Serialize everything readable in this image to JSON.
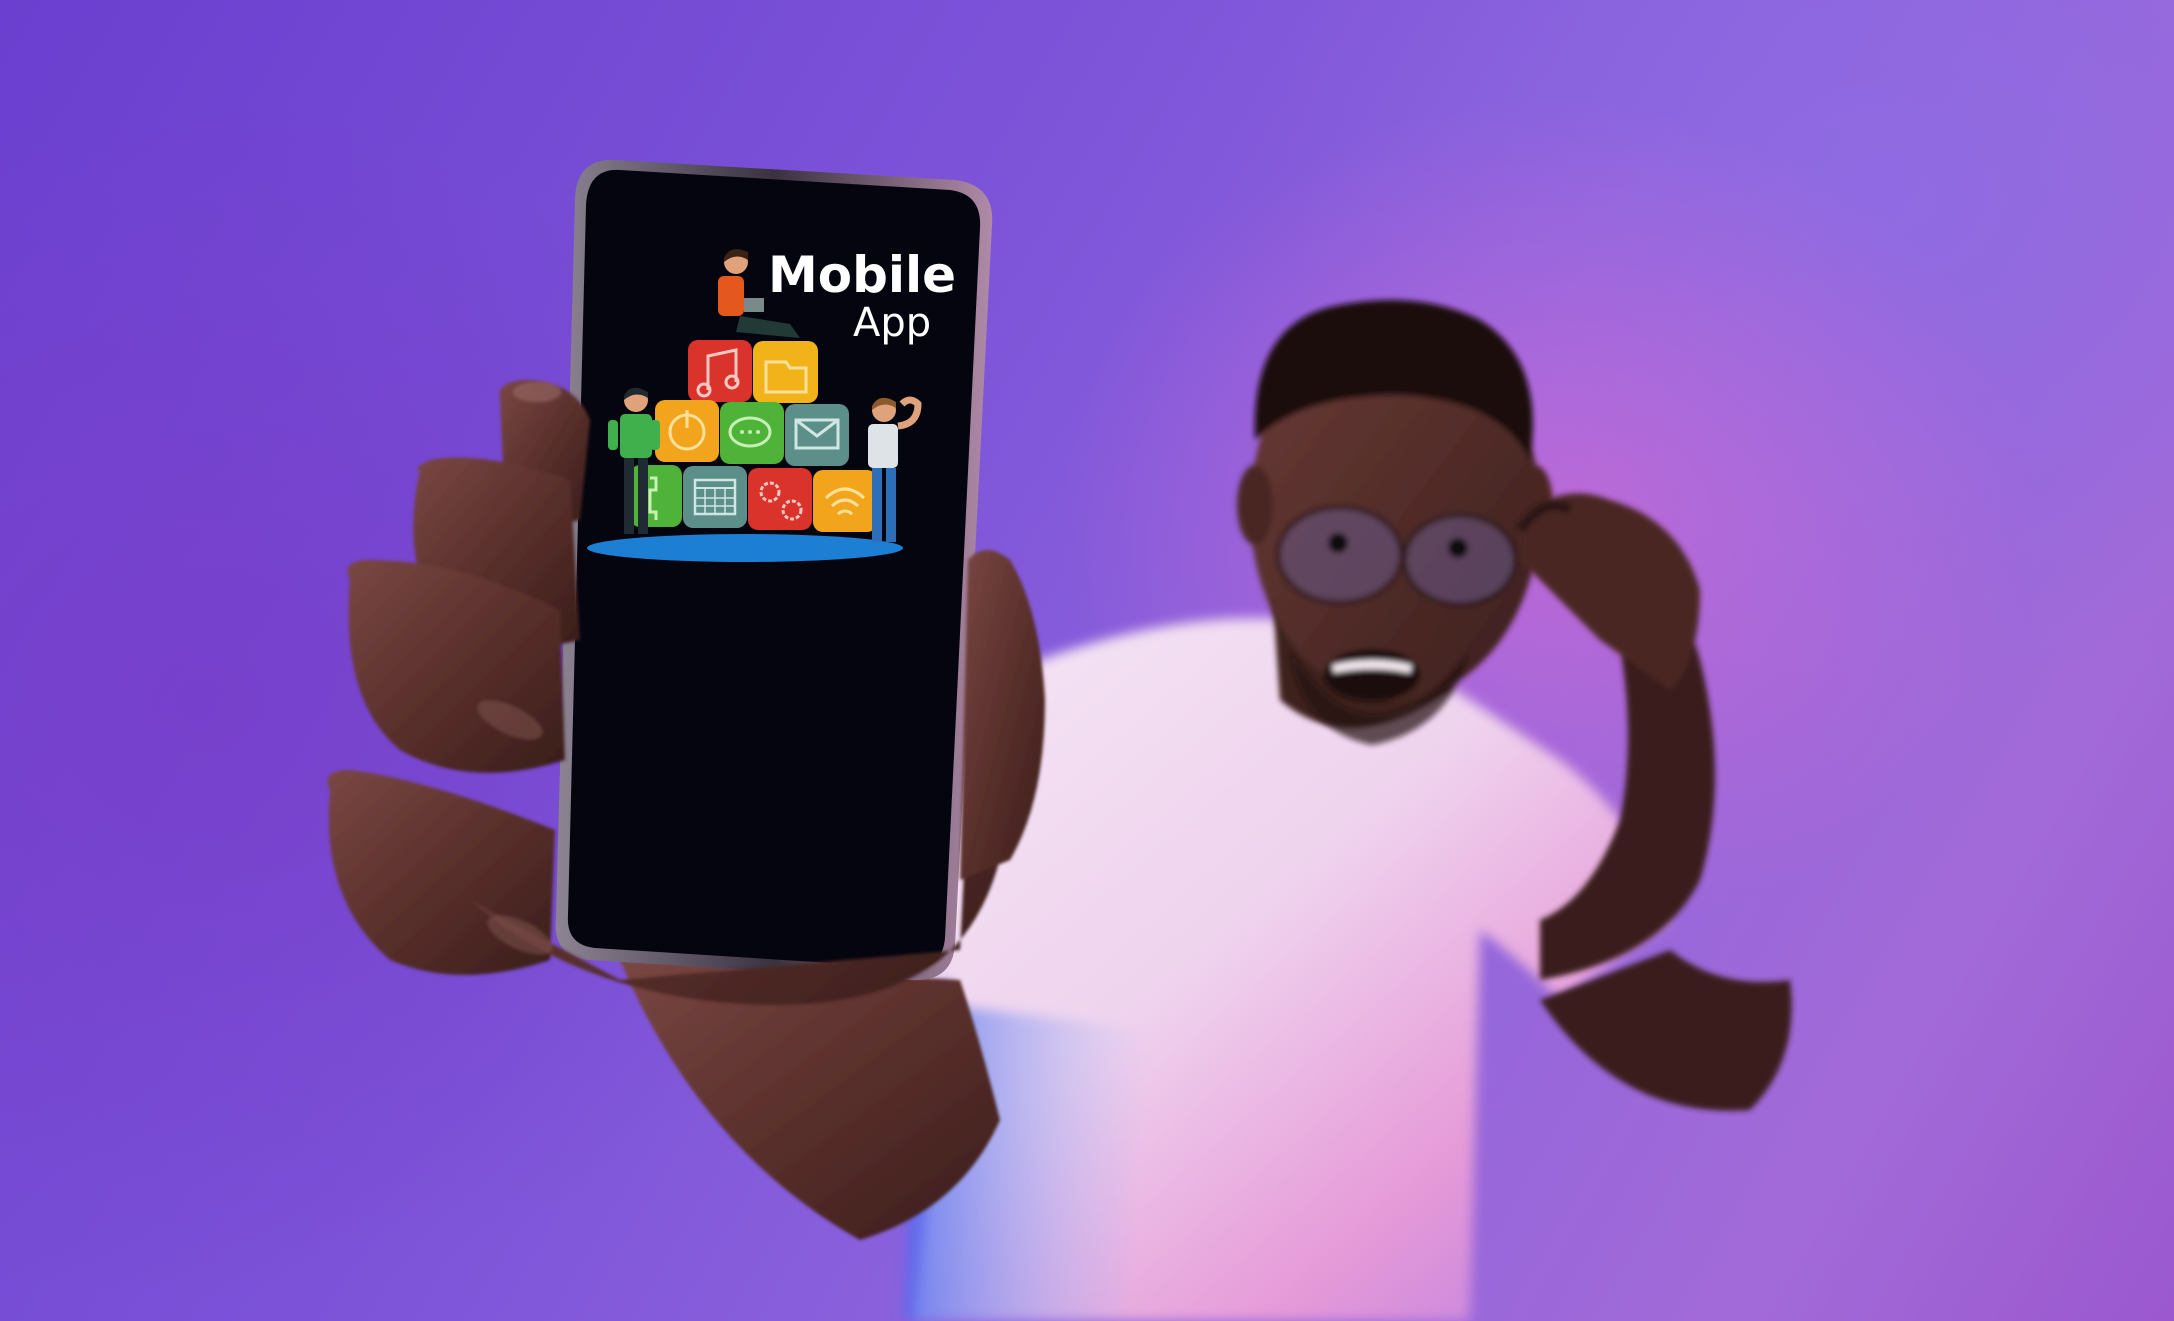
{
  "phone_screen": {
    "title_line1": "Mobile",
    "title_line2": "App",
    "tiles": [
      {
        "icon": "music-note-icon",
        "color": "#d9332b"
      },
      {
        "icon": "folder-icon",
        "color": "#f2b21a"
      },
      {
        "icon": "power-icon",
        "color": "#f2a51c"
      },
      {
        "icon": "chat-bubble-icon",
        "color": "#4fb33a"
      },
      {
        "icon": "mail-icon",
        "color": "#5d8f8a"
      },
      {
        "icon": "phone-icon",
        "color": "#4fb33a"
      },
      {
        "icon": "calendar-icon",
        "color": "#5d8f8a"
      },
      {
        "icon": "gears-icon",
        "color": "#d9332b"
      },
      {
        "icon": "wifi-icon",
        "color": "#f2a51c"
      }
    ]
  },
  "colors": {
    "background": "#7b52d8",
    "screen": "#050510",
    "shirt": "#f0e6f4",
    "skin": "#4a2a22"
  }
}
